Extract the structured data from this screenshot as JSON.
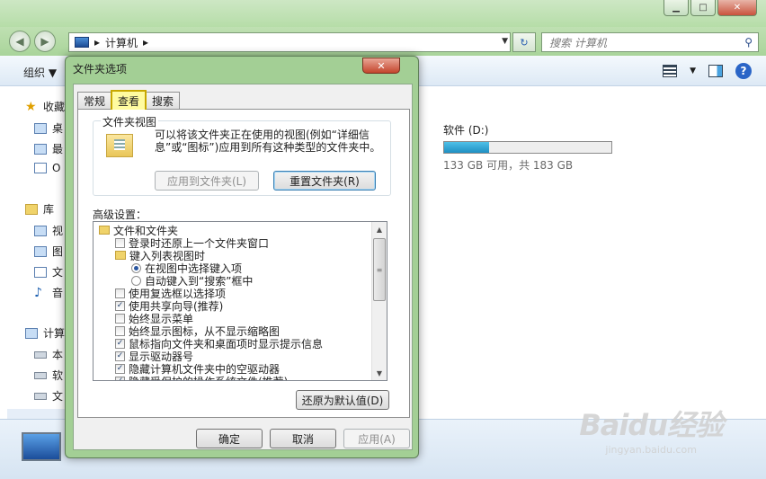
{
  "explorer": {
    "window_controls": {
      "minimize": "▁",
      "maximize": "□",
      "close": "✕"
    },
    "nav": {
      "back": "◀",
      "forward": "▶"
    },
    "address": {
      "separator1": "▸",
      "location": "计算机",
      "separator2": "▸",
      "dropdown": "▼"
    },
    "refresh": "↻",
    "search": {
      "placeholder": "搜索 计算机"
    },
    "cmd": {
      "organize": "组织 ▼",
      "view_dropdown": "▼",
      "help": "?"
    },
    "sidebar": {
      "items": [
        {
          "icon": "star-icon",
          "label": "收藏"
        },
        {
          "icon": "desktop-icon",
          "label": "桌"
        },
        {
          "icon": "recent-icon",
          "label": "最"
        },
        {
          "icon": "document-icon",
          "label": "O"
        },
        {
          "icon": "library-icon",
          "label": "库"
        },
        {
          "icon": "video-icon",
          "label": "视"
        },
        {
          "icon": "picture-icon",
          "label": "图"
        },
        {
          "icon": "document-icon",
          "label": "文"
        },
        {
          "icon": "music-icon",
          "label": "音"
        },
        {
          "icon": "computer-icon",
          "label": "计算"
        },
        {
          "icon": "local-disk-icon",
          "label": "本"
        },
        {
          "icon": "drive-icon",
          "label": "软"
        },
        {
          "icon": "drive-icon",
          "label": "文"
        }
      ]
    },
    "drive_d": {
      "name": "软件 (D:)",
      "info": "133 GB 可用，共 183 GB",
      "used_fraction": 0.27
    }
  },
  "dialog": {
    "title": "文件夹选项",
    "close": "✕",
    "tabs": [
      {
        "label": "常规"
      },
      {
        "label": "查看"
      },
      {
        "label": "搜索"
      }
    ],
    "folder_view": {
      "label": "文件夹视图",
      "description": "可以将该文件夹正在使用的视图(例如“详细信息”或“图标”)应用到所有这种类型的文件夹中。",
      "apply_button": "应用到文件夹(L)",
      "reset_button": "重置文件夹(R)"
    },
    "advanced": {
      "label": "高级设置：",
      "items": [
        {
          "type": "folder",
          "label": "文件和文件夹"
        },
        {
          "type": "checkbox",
          "checked": false,
          "label": "登录时还原上一个文件夹窗口"
        },
        {
          "type": "folder",
          "label": "键入列表视图时"
        },
        {
          "type": "radio",
          "checked": true,
          "label": "在视图中选择键入项"
        },
        {
          "type": "radio",
          "checked": false,
          "label": "自动键入到“搜索”框中"
        },
        {
          "type": "checkbox",
          "checked": false,
          "label": "使用复选框以选择项"
        },
        {
          "type": "checkbox",
          "checked": true,
          "label": "使用共享向导(推荐)"
        },
        {
          "type": "checkbox",
          "checked": false,
          "label": "始终显示菜单"
        },
        {
          "type": "checkbox",
          "checked": false,
          "label": "始终显示图标，从不显示缩略图"
        },
        {
          "type": "checkbox",
          "checked": true,
          "label": "鼠标指向文件夹和桌面项时显示提示信息"
        },
        {
          "type": "checkbox",
          "checked": true,
          "label": "显示驱动器号"
        },
        {
          "type": "checkbox",
          "checked": true,
          "label": "隐藏计算机文件夹中的空驱动器"
        },
        {
          "type": "checkbox",
          "checked": true,
          "label": "隐藏受保护的操作系统文件(推荐)"
        }
      ],
      "check_mark": "✓",
      "scroll_up": "▲",
      "scroll_down": "▼",
      "scroll_grip": "≡",
      "restore_button": "还原为默认值(D)"
    },
    "footer": {
      "ok": "确定",
      "cancel": "取消",
      "apply": "应用(A)"
    }
  },
  "watermark": {
    "brand": "Baidu经验",
    "url": "jingyan.baidu.com"
  }
}
